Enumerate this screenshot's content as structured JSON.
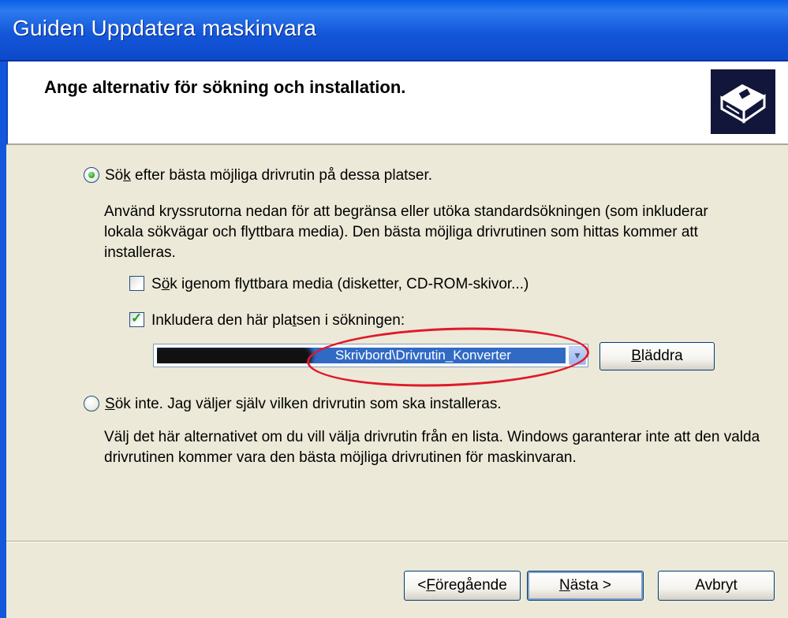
{
  "window": {
    "title": "Guiden Uppdatera maskinvara"
  },
  "header": {
    "heading": "Ange alternativ för sökning och installation.",
    "icon": "hardware-wizard-icon"
  },
  "options": {
    "search": {
      "label_pre": "Sö",
      "label_access": "k",
      "label_post": " efter bästa möjliga drivrutin på dessa platser.",
      "selected": true,
      "description": "Använd kryssrutorna nedan för att begränsa eller utöka standardsökningen (som inkluderar lokala sökvägar och flyttbara media). Den bästa möjliga drivrutinen som hittas kommer att installeras."
    },
    "removable": {
      "label_pre": "S",
      "label_access": "ö",
      "label_post": "k igenom flyttbara media (disketter, CD-ROM-skivor...)",
      "checked": false
    },
    "include_location": {
      "label_pre": "Inkludera den här pla",
      "label_access": "t",
      "label_post": "sen i sökningen:",
      "checked": true
    },
    "path": {
      "value": "Skrivbord\\Drivrutin_Konverter"
    },
    "browse": {
      "label_access": "B",
      "label_post": "läddra"
    },
    "dont_search": {
      "label_access": "S",
      "label_post": "ök inte. Jag väljer själv vilken drivrutin som ska installeras.",
      "selected": false,
      "description": "Välj det här alternativet om du vill välja drivrutin från en lista. Windows garanterar inte att den valda drivrutinen kommer vara den bästa möjliga drivrutinen för maskinvaran."
    }
  },
  "footer": {
    "back": {
      "pre": "< ",
      "access": "F",
      "post": "öregående"
    },
    "next": {
      "access": "N",
      "post": "ästa >"
    },
    "cancel": {
      "label": "Avbryt"
    }
  },
  "colors": {
    "titlebar": "#1457DA",
    "selection": "#316AC5",
    "annotation": "#E0192A",
    "dialog_bg": "#ECE9D8"
  }
}
